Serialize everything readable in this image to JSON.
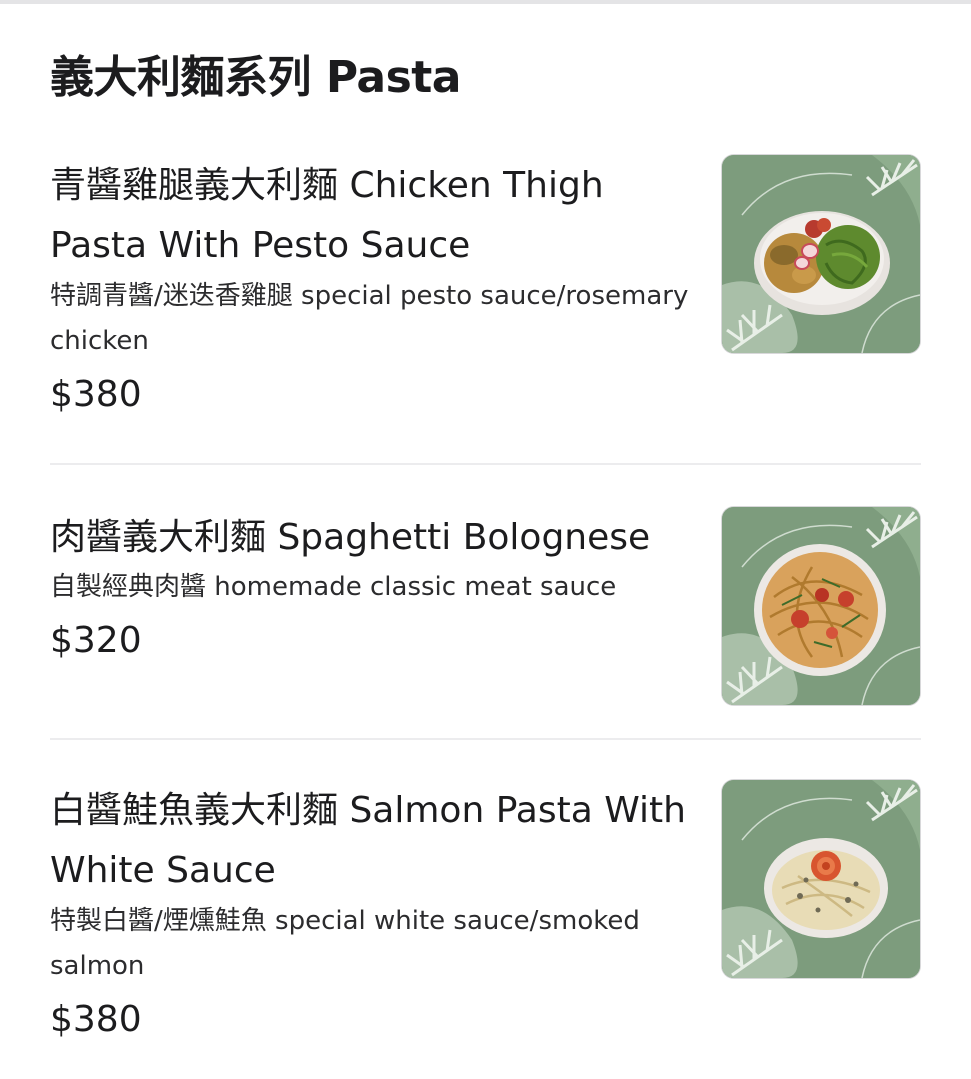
{
  "section": {
    "title": "義大利麵系列 Pasta"
  },
  "items": [
    {
      "name": "青醬雞腿義大利麵 Chicken Thigh Pasta With Pesto Sauce",
      "description": "特調青醬/迷迭香雞腿  special pesto sauce/rosemary chicken",
      "price": "$380",
      "image": "pesto-chicken-pasta-photo"
    },
    {
      "name": "肉醬義大利麵 Spaghetti Bolognese",
      "description": "自製經典肉醬 homemade classic meat sauce",
      "price": "$320",
      "image": "bolognese-pasta-photo"
    },
    {
      "name": "白醬鮭魚義大利麵 Salmon Pasta With White Sauce",
      "description": "特製白醬/煙燻鮭魚  special white sauce/smoked salmon",
      "price": "$380",
      "image": "salmon-pasta-photo"
    }
  ],
  "colors": {
    "thumb_bg": "#7d9c7d",
    "thumb_leaf": "#b9ccb7",
    "divider": "#ececee",
    "text": "#1c1c1e"
  }
}
